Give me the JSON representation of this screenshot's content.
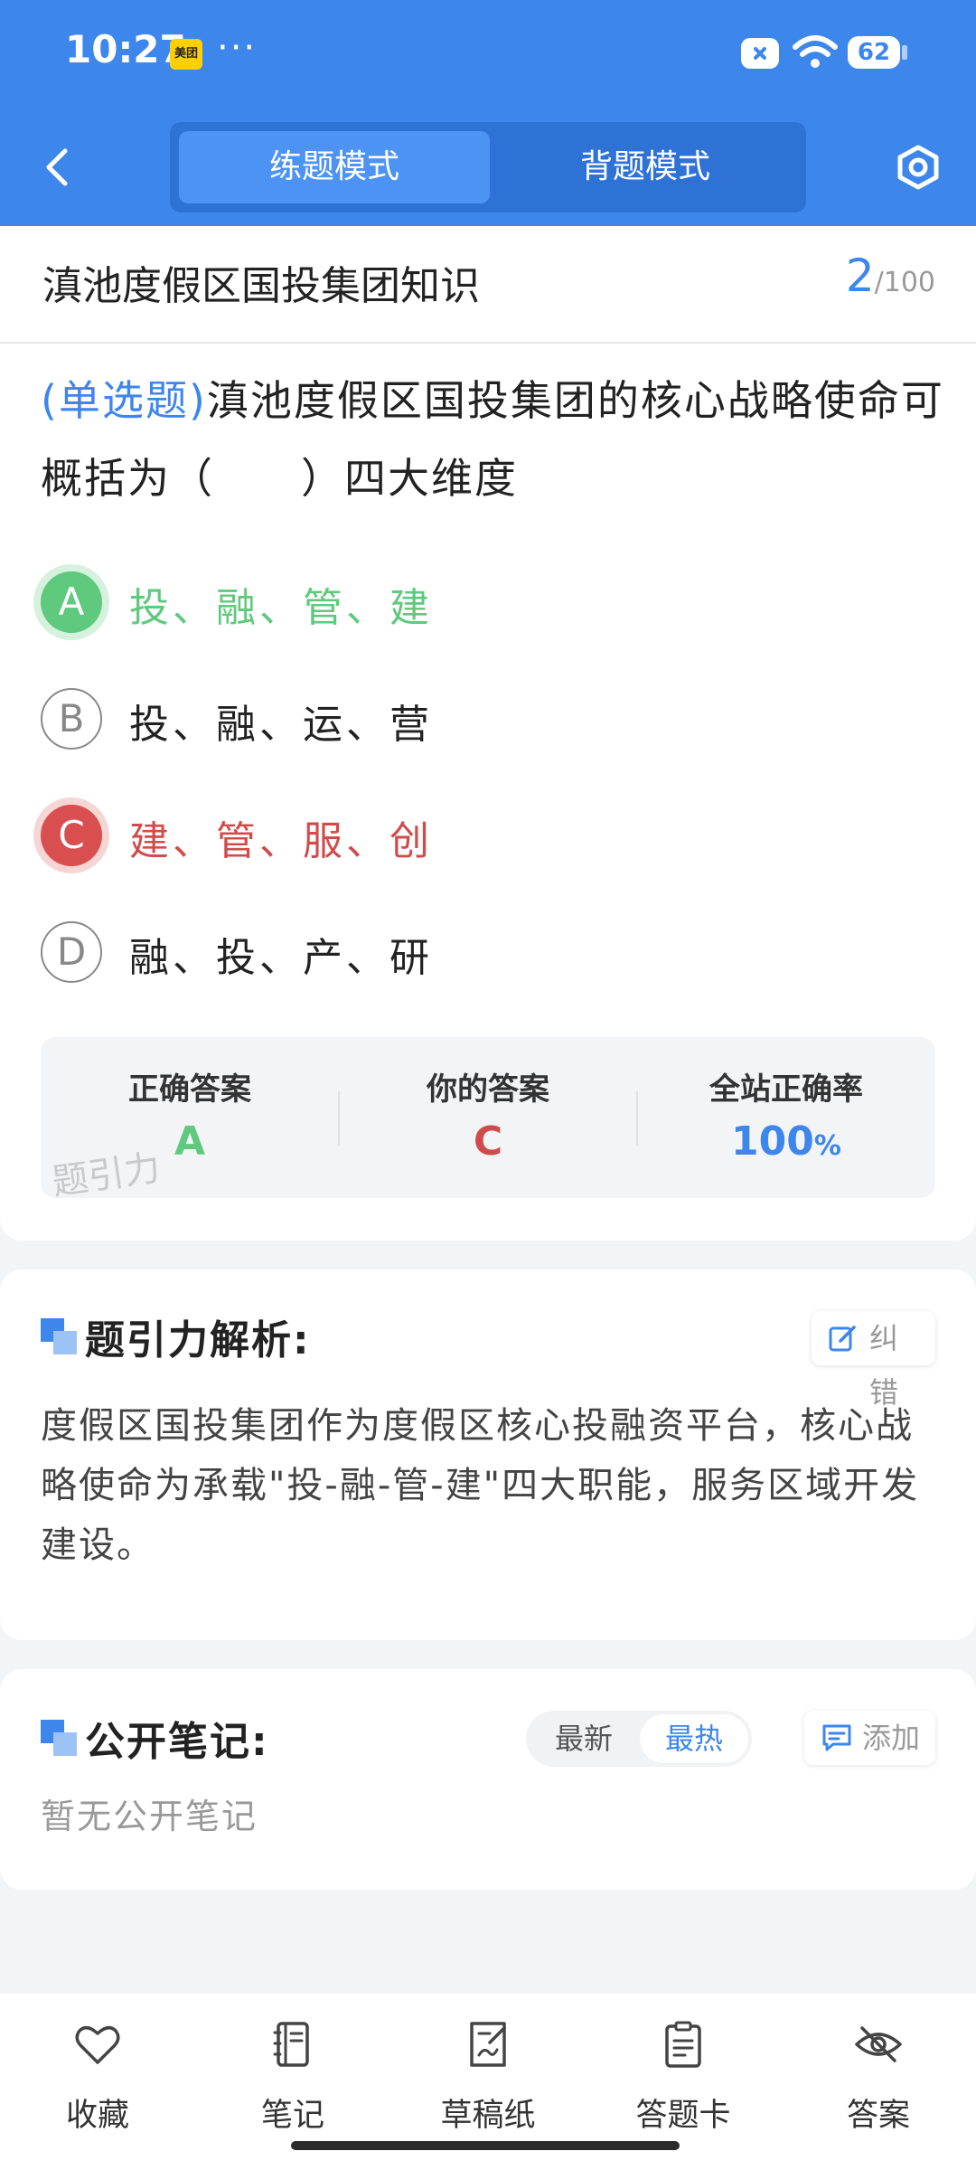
{
  "status_bar": {
    "time": "10:27",
    "app_badge": "美团",
    "more": "···",
    "battery": "62"
  },
  "header": {
    "modes": [
      "练题模式",
      "背题模式"
    ],
    "active_mode": "练题模式"
  },
  "question_card": {
    "title": "滇池度假区国投集团知识",
    "current": "2",
    "total": "/100",
    "type_label": "(单选题)",
    "question_text": "滇池度假区国投集团的核心战略使命可概括为（　　）四大维度",
    "options": [
      {
        "letter": "A",
        "text": "投、融、管、建",
        "state": "correct"
      },
      {
        "letter": "B",
        "text": "投、融、运、营",
        "state": "normal"
      },
      {
        "letter": "C",
        "text": "建、管、服、创",
        "state": "wrong"
      },
      {
        "letter": "D",
        "text": "融、投、产、研",
        "state": "normal"
      }
    ],
    "result": {
      "correct_label": "正确答案",
      "correct_value": "A",
      "yours_label": "你的答案",
      "yours_value": "C",
      "rate_label": "全站正确率",
      "rate_value": "100",
      "rate_unit": "%",
      "watermark": "题引力"
    }
  },
  "analysis": {
    "heading": "题引力解析:",
    "report_button": "纠错",
    "text": "度假区国投集团作为度假区核心投融资平台，核心战略使命为承载\"投-融-管-建\"四大职能，服务区域开发建设。"
  },
  "notes": {
    "heading": "公开笔记:",
    "sort_options": [
      "最新",
      "最热"
    ],
    "active_sort": "最热",
    "add_button": "添加",
    "empty_text": "暂无公开笔记"
  },
  "bottom_nav": [
    {
      "label": "收藏",
      "icon": "heart-icon"
    },
    {
      "label": "笔记",
      "icon": "notebook-icon"
    },
    {
      "label": "草稿纸",
      "icon": "draft-icon"
    },
    {
      "label": "答题卡",
      "icon": "clipboard-icon"
    },
    {
      "label": "答案",
      "icon": "eye-off-icon"
    }
  ],
  "colors": {
    "primary": "#3d86ec",
    "correct": "#5fc97d",
    "wrong": "#d24b4b"
  }
}
